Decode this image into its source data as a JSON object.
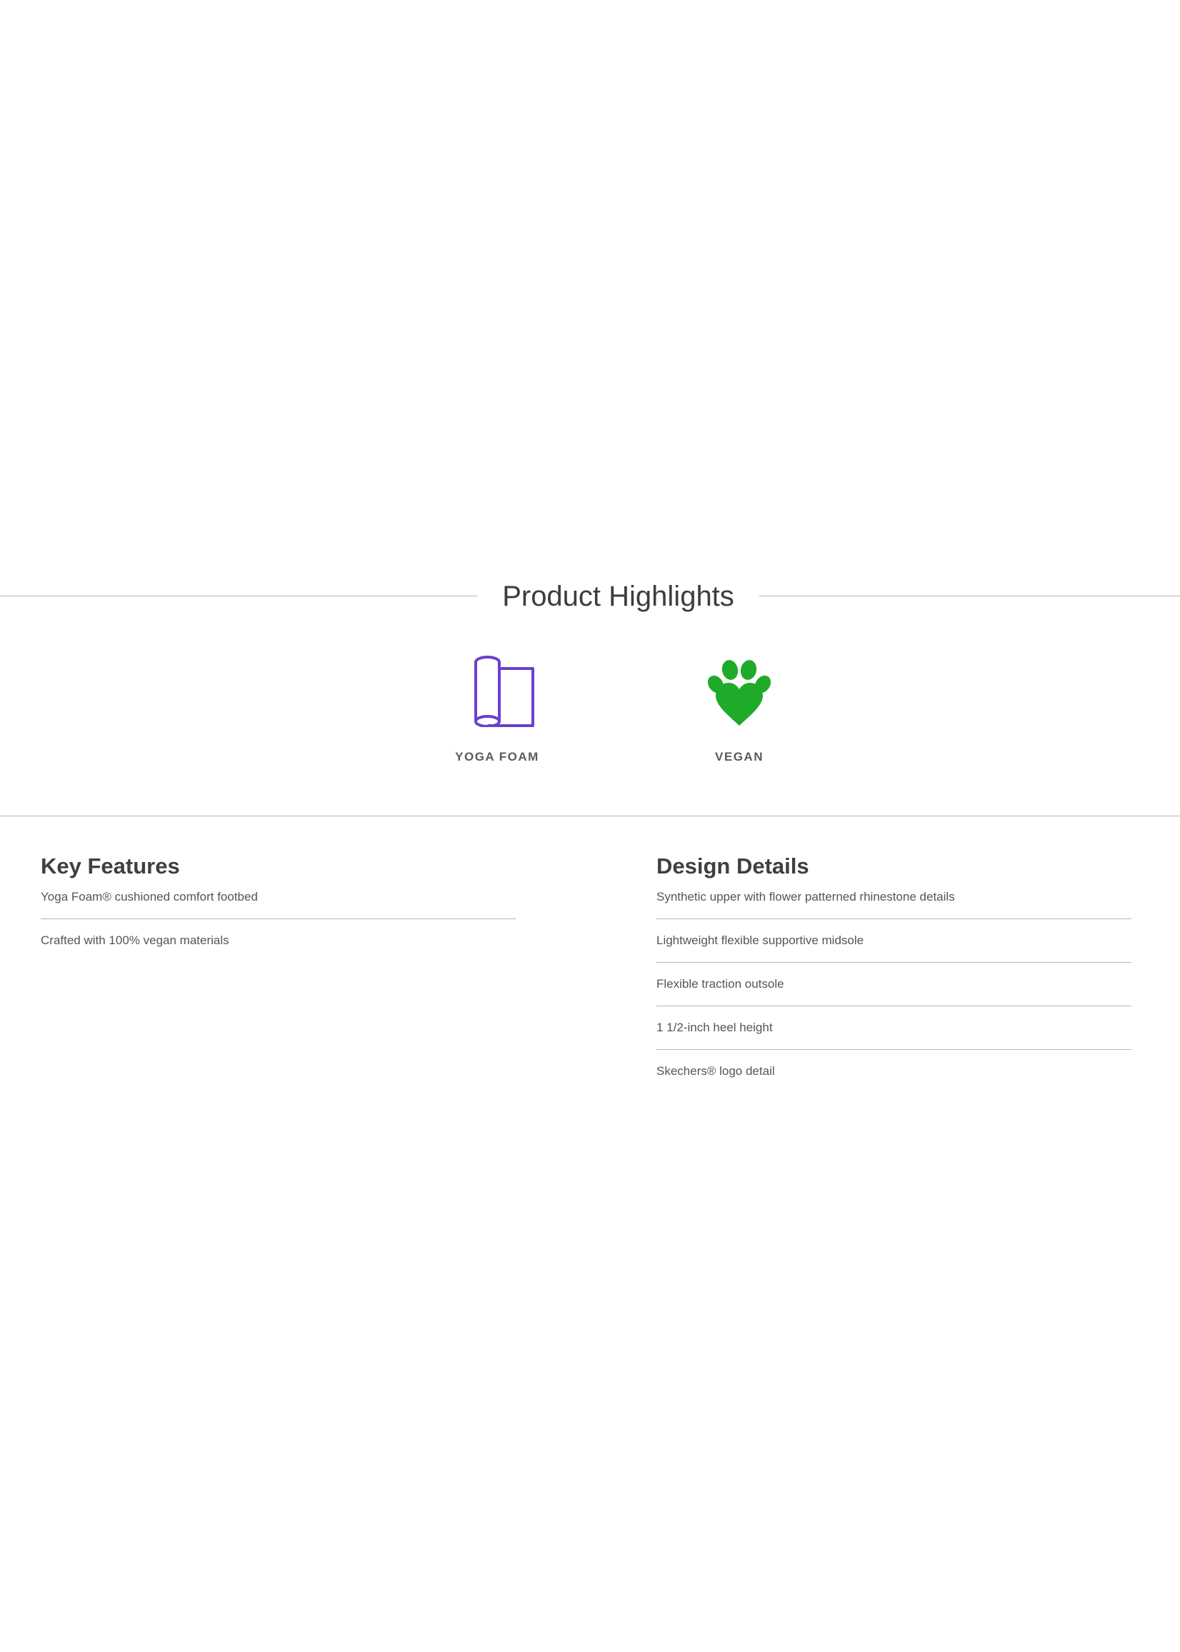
{
  "highlights": {
    "title": "Product Highlights",
    "items": [
      {
        "label": "YOGA FOAM",
        "icon": "yoga-mat-icon",
        "color": "#6a3fcf"
      },
      {
        "label": "VEGAN",
        "icon": "paw-heart-icon",
        "color": "#1faa2a"
      }
    ]
  },
  "key_features": {
    "heading": "Key Features",
    "items": [
      "Yoga Foam® cushioned comfort footbed",
      "Crafted with 100% vegan materials"
    ]
  },
  "design_details": {
    "heading": "Design Details",
    "items": [
      "Synthetic upper with flower patterned rhinestone details",
      "Lightweight flexible supportive midsole",
      "Flexible traction outsole",
      "1 1/2-inch heel height",
      "Skechers® logo detail"
    ]
  }
}
